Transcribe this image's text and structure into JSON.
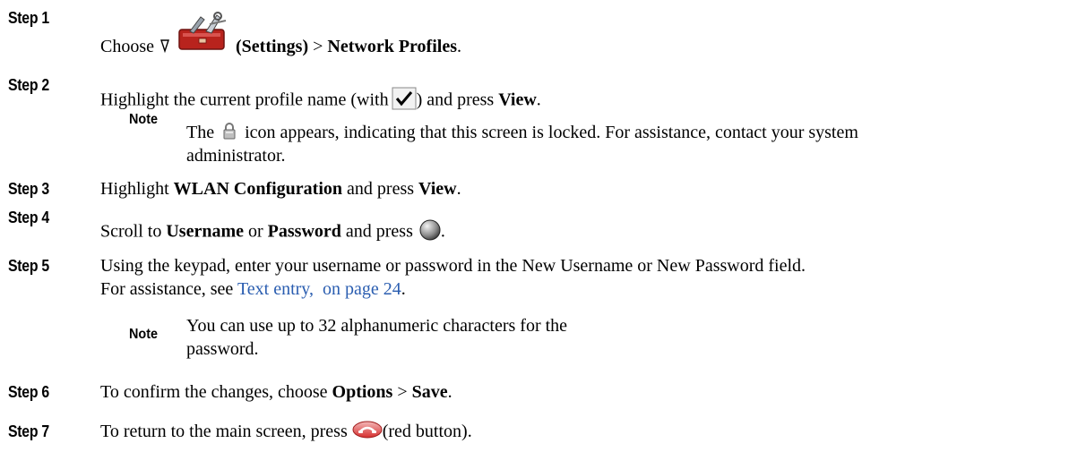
{
  "steps": [
    {
      "label": "Step 1",
      "parts": {
        "choose": "Choose",
        "settings": "(Settings)",
        "gt": ">",
        "network_profiles": "Network Profiles",
        "period": "."
      }
    },
    {
      "label": "Step 2",
      "parts": {
        "text_a": "Highlight the current profile name (with",
        "text_b": ") and press",
        "view": "View",
        "period": "."
      },
      "note": {
        "label": "Note",
        "text_a": "The",
        "text_b": "icon appears, indicating that this screen is locked. For assistance, contact your system",
        "text_c": "administrator."
      }
    },
    {
      "label": "Step 3",
      "parts": {
        "highlight": "Highlight",
        "wlan": "WLAN Configuration",
        "and_press": "and press",
        "view": "View",
        "period": "."
      }
    },
    {
      "label": "Step 4",
      "parts": {
        "scroll_to": "Scroll to",
        "username": "Username",
        "or": "or",
        "password": "Password",
        "and_press": "and press",
        "period": "."
      }
    },
    {
      "label": "Step 5",
      "parts": {
        "line1": "Using the keypad, enter your username or password in the New Username or New Password field.",
        "for_assistance": "For assistance, see",
        "link": "Text entry,  on page 24",
        "period": "."
      },
      "note": {
        "label": "Note",
        "line1": "You can use up to 32 alphanumeric characters for the",
        "line2": "password."
      }
    },
    {
      "label": "Step 6",
      "parts": {
        "text_a": "To confirm the changes, choose",
        "options": "Options",
        "gt": ">",
        "save": "Save",
        "period": "."
      }
    },
    {
      "label": "Step 7",
      "parts": {
        "text_a": "To return to the main screen, press",
        "text_b": "(red button)."
      }
    }
  ],
  "icons": {
    "settings_arrow": "down-triangle-icon",
    "settings": "toolbox-settings-icon",
    "checkmark": "checkmark-box-icon",
    "lock": "lock-icon",
    "select_button": "select-button-icon",
    "red_button": "red-end-call-button-icon"
  },
  "colors": {
    "text": "#000000",
    "link": "#2a5db0",
    "toolbox_red": "#b8231d",
    "end_call_red": "#d62e2e"
  }
}
